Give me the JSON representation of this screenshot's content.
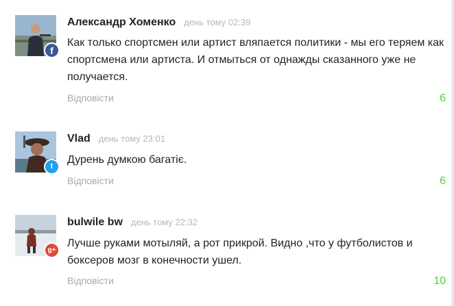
{
  "reply_label": "Відповісти",
  "comments": [
    {
      "author": "Александр Хоменко",
      "date": "день тому 02:39",
      "text": "Как только спортсмен или артист вляпается политики - мы его теряем как спортсмена или артиста. И отмыться от однажды сказанного уже не получается.",
      "rating": "6",
      "network": "facebook-icon",
      "network_glyph": "f"
    },
    {
      "author": "Vlad",
      "date": "день тому 23:01",
      "text": "Дурень думкою багатіє.",
      "rating": "6",
      "network": "twitter-icon",
      "network_glyph": "t"
    },
    {
      "author": "bulwile bw",
      "date": "день тому 22:32",
      "text": "Лучше руками мотыляй, а рот прикрой. Видно ,что у футболистов и боксеров мозг в конечности ушел.",
      "rating": "10",
      "network": "google-plus-icon",
      "network_glyph": "g+"
    }
  ],
  "colors": {
    "rating": "#4cd137",
    "reply": "#a8a8a8",
    "date": "#b7b7b7"
  }
}
